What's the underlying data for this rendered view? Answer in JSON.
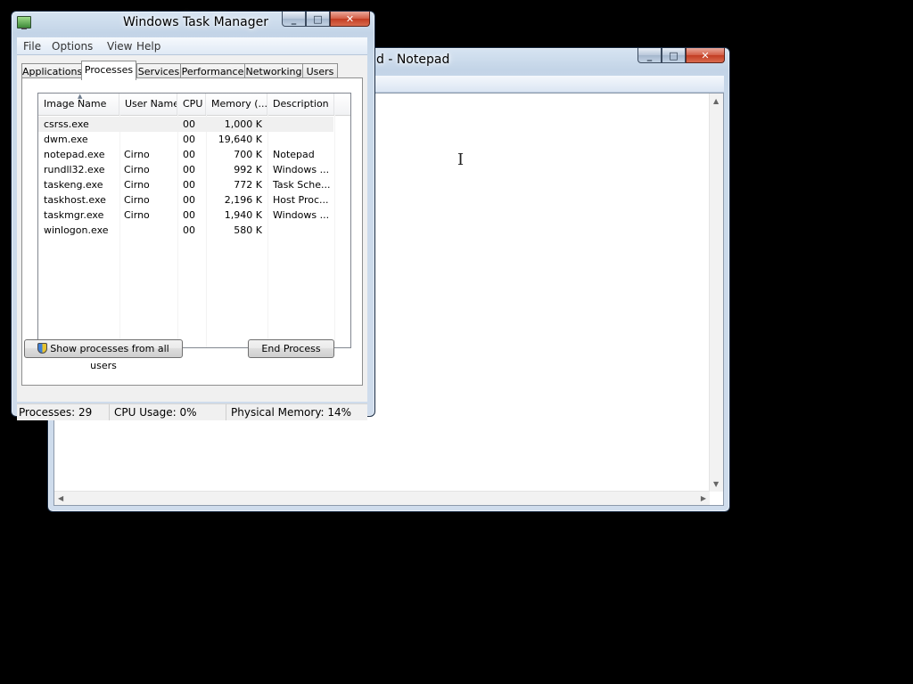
{
  "notepad": {
    "title": "d - Notepad",
    "minimize": "_",
    "maximize": "□",
    "close": "✕",
    "cursor_icon": "i-beam-cursor-icon"
  },
  "taskmgr": {
    "title": "Windows Task Manager",
    "icon": "task-manager-icon",
    "minimize": "_",
    "maximize": "□",
    "close": "✕",
    "menu": [
      "File",
      "Options",
      "View",
      "Help"
    ],
    "tabs": [
      "Applications",
      "Processes",
      "Services",
      "Performance",
      "Networking",
      "Users"
    ],
    "active_tab": "Processes",
    "columns": [
      "Image Name",
      "User Name",
      "CPU",
      "Memory (...",
      "Description"
    ],
    "sorted_column": "Image Name",
    "rows": [
      {
        "image": "csrss.exe",
        "user": "",
        "cpu": "00",
        "memory": "1,000 K",
        "desc": ""
      },
      {
        "image": "dwm.exe",
        "user": "",
        "cpu": "00",
        "memory": "19,640 K",
        "desc": ""
      },
      {
        "image": "notepad.exe",
        "user": "Cirno",
        "cpu": "00",
        "memory": "700 K",
        "desc": "Notepad"
      },
      {
        "image": "rundll32.exe",
        "user": "Cirno",
        "cpu": "00",
        "memory": "992 K",
        "desc": "Windows ..."
      },
      {
        "image": "taskeng.exe",
        "user": "Cirno",
        "cpu": "00",
        "memory": "772 K",
        "desc": "Task Sche..."
      },
      {
        "image": "taskhost.exe",
        "user": "Cirno",
        "cpu": "00",
        "memory": "2,196 K",
        "desc": "Host Proc..."
      },
      {
        "image": "taskmgr.exe",
        "user": "Cirno",
        "cpu": "00",
        "memory": "1,940 K",
        "desc": "Windows ..."
      },
      {
        "image": "winlogon.exe",
        "user": "",
        "cpu": "00",
        "memory": "580 K",
        "desc": ""
      }
    ],
    "selected_row": "csrss.exe",
    "show_all_button": "Show processes from all users",
    "end_process_button": "End Process",
    "status": {
      "processes": "Processes: 29",
      "cpu": "CPU Usage: 0%",
      "memory": "Physical Memory: 14%"
    }
  }
}
